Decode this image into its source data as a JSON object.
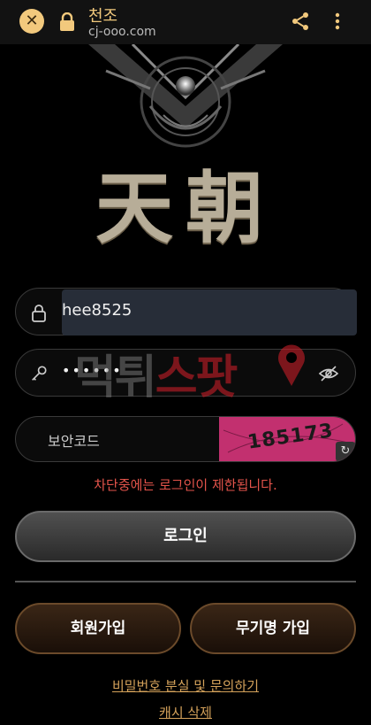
{
  "browser": {
    "title": "천조",
    "url": "cj-ooo.com",
    "close_icon": "close-icon",
    "lock_icon": "lock-icon",
    "share_icon": "share-icon",
    "menu_icon": "more-vertical-icon"
  },
  "logo": {
    "text": "天朝"
  },
  "form": {
    "username": {
      "value": "hee8525",
      "icon": "lock-icon"
    },
    "password": {
      "value": "••••••",
      "icon": "key-icon",
      "toggle_icon": "eye-off-icon"
    },
    "captcha": {
      "placeholder": "보안코드",
      "code": "185173",
      "refresh_icon": "refresh-icon"
    },
    "error": "차단중에는 로그인이 제한됩니다.",
    "login_label": "로그인"
  },
  "watermark": {
    "part1": "먹튀",
    "part2": "스팟"
  },
  "actions": {
    "signup_label": "회원가입",
    "anon_signup_label": "무기명 가입"
  },
  "links": {
    "forgot_label": "비밀번호 분실 및 문의하기",
    "cache_label": "캐시 삭제"
  },
  "colors": {
    "accent": "#f2c97d",
    "error": "#e4544b",
    "link": "#d3a15a",
    "captcha_bg": "#c2306f"
  }
}
